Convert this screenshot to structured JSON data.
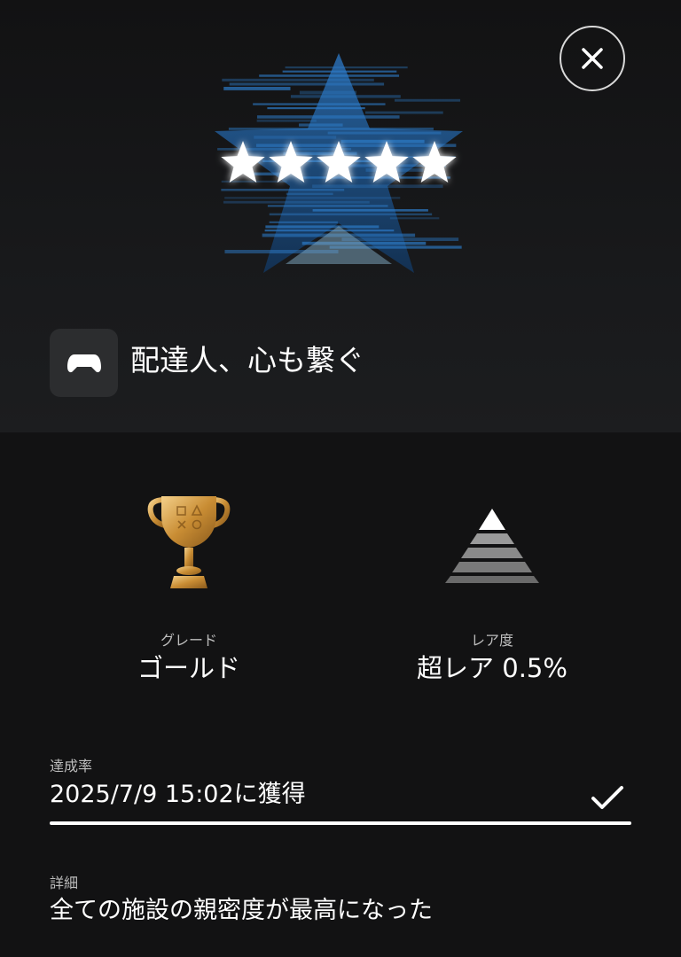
{
  "header": {
    "close_icon": "close-icon",
    "trophy_image": "five-star-trophy-art"
  },
  "trophy": {
    "game_icon": "gamepad-icon",
    "title": "配達人、心も繋ぐ"
  },
  "stats": {
    "grade": {
      "label": "グレード",
      "value": "ゴールド",
      "icon": "gold-trophy-icon"
    },
    "rarity": {
      "label": "レア度",
      "value": "超レア 0.5%",
      "icon": "rarity-pyramid-icon"
    }
  },
  "achievement": {
    "label": "達成率",
    "value": "2025/7/9  15:02に獲得",
    "progress": 1.0,
    "status_icon": "checkmark-icon"
  },
  "details": {
    "label": "詳細",
    "value": "全ての施設の親密度が最高になった"
  },
  "colors": {
    "background": "#121213",
    "gold": "#d6a24a",
    "star_blue": "#1f5fa0",
    "white": "#ffffff"
  }
}
